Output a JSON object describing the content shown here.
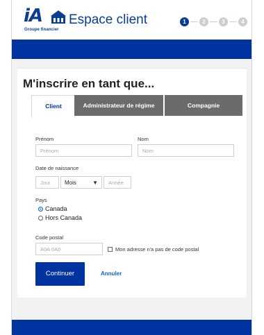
{
  "header": {
    "logo_text": "iA",
    "logo_sub": "Groupe financier",
    "app_title": "Espace client",
    "steps": [
      "1",
      "2",
      "3",
      "4"
    ]
  },
  "form": {
    "title": "M'inscrire en tant que...",
    "tabs": [
      {
        "label": "Client",
        "active": true
      },
      {
        "label": "Administrateur de régime",
        "active": false
      },
      {
        "label": "Compagnie",
        "active": false
      }
    ],
    "prenom_label": "Prénom",
    "prenom_placeholder": "Prénom",
    "nom_label": "Nom",
    "nom_placeholder": "Nom",
    "dob_label": "Date de naissance",
    "jour_placeholder": "Jour",
    "mois_value": "Mois",
    "annee_placeholder": "Année",
    "pays_label": "Pays",
    "pays_options": [
      {
        "label": "Canada",
        "selected": true
      },
      {
        "label": "Hors Canada",
        "selected": false
      }
    ],
    "postal_label": "Code postal",
    "postal_placeholder": "A0A 0A0",
    "no_postal_label": "Mon adresse n'a pas de code postal",
    "continue_label": "Continuer",
    "cancel_label": "Annuler"
  },
  "colors": {
    "brand_blue": "#0033a0",
    "logo_blue": "#0b3d91",
    "link_blue": "#0b63ce"
  }
}
